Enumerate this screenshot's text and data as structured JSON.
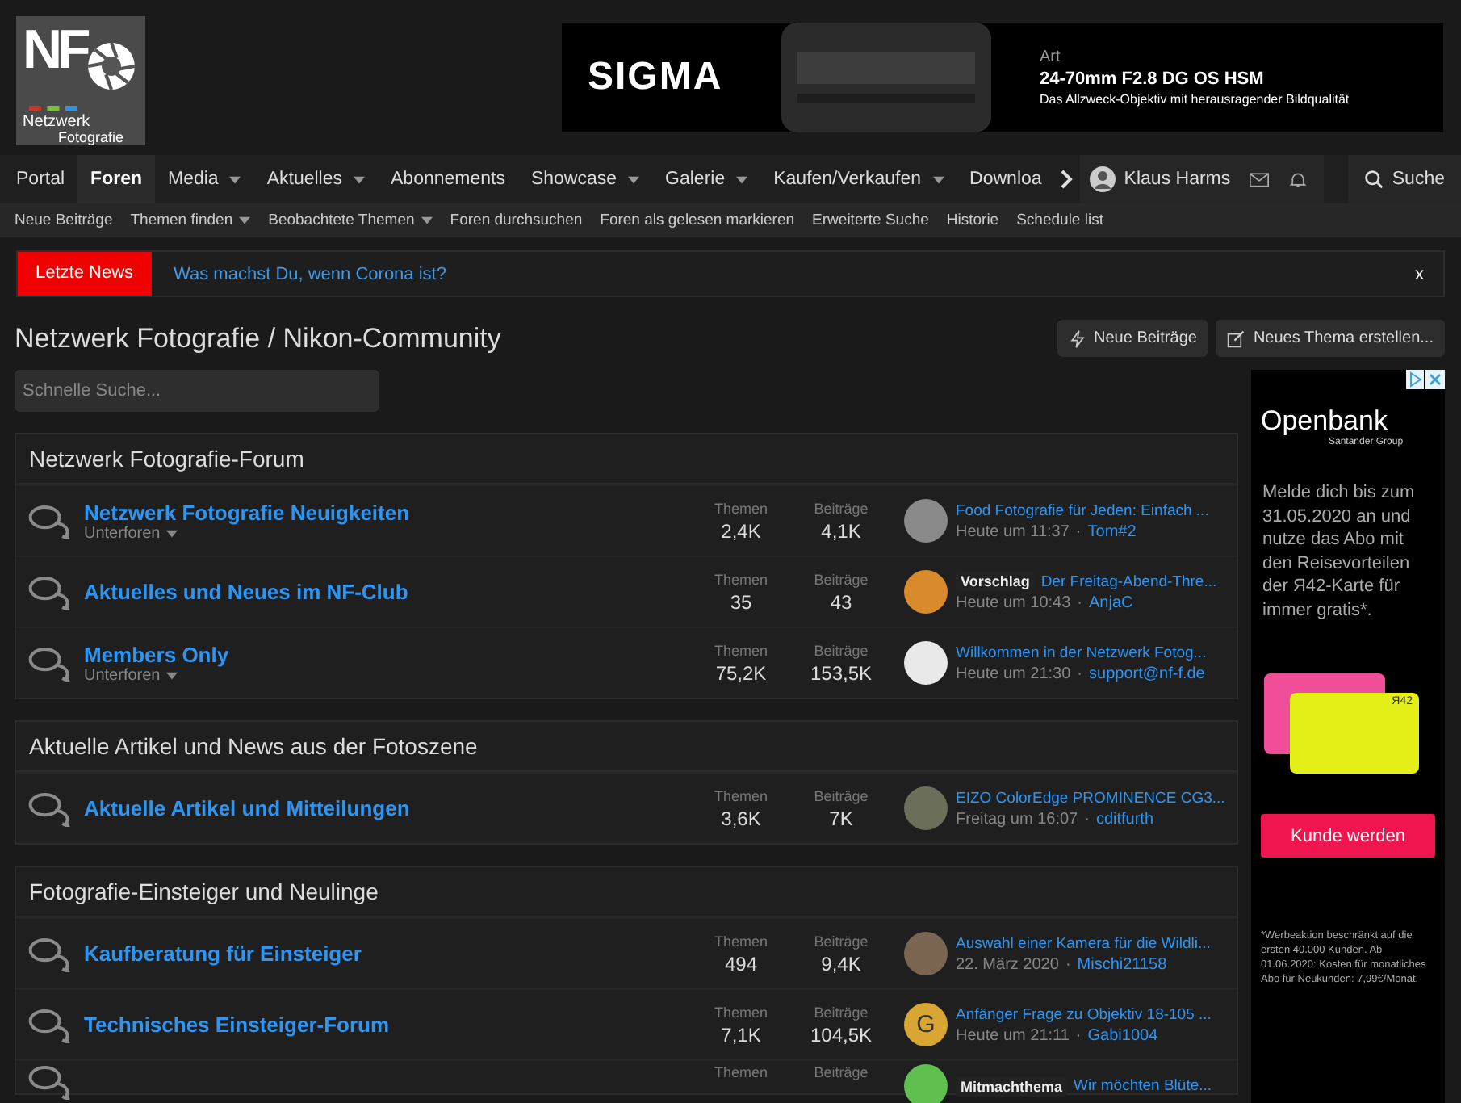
{
  "logo": {
    "initials": "NF",
    "line1": "Netzwerk",
    "line2": "Fotografie"
  },
  "banner": {
    "brand": "SIGMA",
    "series": "Art",
    "model": "24-70mm F2.8 DG OS HSM",
    "tagline": "Das Allzweck-Objektiv mit herausragender Bildqualität"
  },
  "nav": {
    "items": [
      {
        "label": "Portal",
        "selected": false,
        "dropdown": false
      },
      {
        "label": "Foren",
        "selected": true,
        "dropdown": false
      },
      {
        "label": "Media",
        "selected": false,
        "dropdown": true
      },
      {
        "label": "Aktuelles",
        "selected": false,
        "dropdown": true
      },
      {
        "label": "Abonnements",
        "selected": false,
        "dropdown": false
      },
      {
        "label": "Showcase",
        "selected": false,
        "dropdown": true
      },
      {
        "label": "Galerie",
        "selected": false,
        "dropdown": true
      },
      {
        "label": "Kaufen/Verkaufen",
        "selected": false,
        "dropdown": true
      },
      {
        "label": "Downloa",
        "selected": false,
        "dropdown": false
      }
    ],
    "user": "Klaus Harms",
    "search": "Suche"
  },
  "subnav": [
    {
      "label": "Neue Beiträge",
      "dropdown": false
    },
    {
      "label": "Themen finden",
      "dropdown": true
    },
    {
      "label": "Beobachtete Themen",
      "dropdown": true
    },
    {
      "label": "Foren durchsuchen",
      "dropdown": false
    },
    {
      "label": "Foren als gelesen markieren",
      "dropdown": false
    },
    {
      "label": "Erweiterte Suche",
      "dropdown": false
    },
    {
      "label": "Historie",
      "dropdown": false
    },
    {
      "label": "Schedule list",
      "dropdown": false
    }
  ],
  "news": {
    "label": "Letzte News",
    "text": "Was machst Du, wenn Corona ist?",
    "close": "x"
  },
  "page_title": "Netzwerk Fotografie / Nikon-Community",
  "actions": [
    "Neue Beiträge",
    "Neues Thema erstellen..."
  ],
  "quick_search": {
    "placeholder": "Schnelle Suche..."
  },
  "sections": [
    {
      "title": "Netzwerk Fotografie-Forum",
      "rows": [
        {
          "title": "Netzwerk Fotografie Neuigkeiten",
          "subforums": "Unterforen",
          "themen_label": "Themen",
          "themen": "2,4K",
          "beitraege_label": "Beiträge",
          "beitraege": "4,1K",
          "avatar": {
            "kind": "photo",
            "color": "#8a8a8a"
          },
          "latest": "Food Fotografie für Jeden: Einfach ...",
          "time": "Heute um 11:37",
          "separator": "·",
          "user": "Tom#2"
        },
        {
          "title": "Aktuelles und Neues im NF-Club",
          "themen_label": "Themen",
          "themen": "35",
          "beitraege_label": "Beiträge",
          "beitraege": "43",
          "avatar": {
            "kind": "photo",
            "color": "#d98a2b"
          },
          "prefix": "Vorschlag",
          "latest": "Der Freitag-Abend-Thre...",
          "time": "Heute um 10:43",
          "separator": "·",
          "user": "AnjaC"
        },
        {
          "title": "Members Only",
          "subforums": "Unterforen",
          "themen_label": "Themen",
          "themen": "75,2K",
          "beitraege_label": "Beiträge",
          "beitraege": "153,5K",
          "avatar": {
            "kind": "photo",
            "color": "#e8e8e8"
          },
          "latest": "Willkommen in der Netzwerk Fotog...",
          "time": "Heute um 21:30",
          "separator": "·",
          "user": "support@nf-f.de"
        }
      ]
    },
    {
      "title": "Aktuelle Artikel und News aus der Fotoszene",
      "rows": [
        {
          "title": "Aktuelle Artikel und Mitteilungen",
          "themen_label": "Themen",
          "themen": "3,6K",
          "beitraege_label": "Beiträge",
          "beitraege": "7K",
          "avatar": {
            "kind": "photo",
            "color": "#6b6f5a"
          },
          "latest": "EIZO ColorEdge PROMINENCE CG3...",
          "time": "Freitag um 16:07",
          "separator": "·",
          "user": "cditfurth"
        }
      ]
    },
    {
      "title": "Fotografie-Einsteiger und Neulinge",
      "rows": [
        {
          "title": "Kaufberatung für Einsteiger",
          "themen_label": "Themen",
          "themen": "494",
          "beitraege_label": "Beiträge",
          "beitraege": "9,4K",
          "avatar": {
            "kind": "photo",
            "color": "#7a6550"
          },
          "latest": "Auswahl einer Kamera für die Wildli...",
          "time": "22. März 2020",
          "separator": "·",
          "user": "Mischi21158"
        },
        {
          "title": "Technisches Einsteiger-Forum",
          "themen_label": "Themen",
          "themen": "7,1K",
          "beitraege_label": "Beiträge",
          "beitraege": "104,5K",
          "avatar": {
            "kind": "letter",
            "letter": "G",
            "color": "#d9a634"
          },
          "latest": "Anfänger Frage zu Objektiv 18-105 ...",
          "time": "Heute um 21:11",
          "separator": "·",
          "user": "Gabi1004"
        },
        {
          "themen_label": "Themen",
          "beitraege_label": "Beiträge",
          "avatar": {
            "kind": "letter",
            "color": "#5fbf4f"
          },
          "prefix": "Mitmachthema",
          "latest": "Wir möchten Blüte..."
        }
      ]
    }
  ],
  "ad": {
    "brand": "Openbank",
    "group": "Santander Group",
    "text": "Melde dich bis zum 31.05.2020 an und nutze das Abo mit den Reisevorteilen der Я42-Karte für immer gratis*.",
    "card_mark": "Я42",
    "button": "Kunde werden",
    "footnote": "*Werbeaktion beschränkt auf die ersten 40.000 Kunden. Ab 01.06.2020: Kosten für monatliches Abo für Neukunden: 7,99€/Monat."
  }
}
